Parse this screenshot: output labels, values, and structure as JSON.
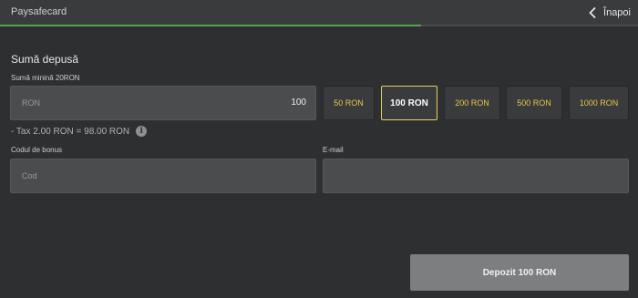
{
  "header": {
    "title": "Paysafecard",
    "back_label": "Înapoi",
    "back_icon": "chevron-left-icon"
  },
  "progress": {
    "fraction": 0.66,
    "color": "#4fa64a"
  },
  "deposit": {
    "section_title": "Sumă depusă",
    "min_label": "Sumă minină 20RON",
    "currency": "RON",
    "amount": "100",
    "presets": [
      {
        "label": "50 RON",
        "selected": false
      },
      {
        "label": "100 RON",
        "selected": true
      },
      {
        "label": "200 RON",
        "selected": false
      },
      {
        "label": "500 RON",
        "selected": false
      },
      {
        "label": "1000 RON",
        "selected": false
      }
    ],
    "tax_text": "- Tax 2.00 RON = 98.00 RON",
    "info_icon": "info-icon"
  },
  "form": {
    "bonus_label": "Codul de bonus",
    "bonus_placeholder": "Cod",
    "email_label": "E-mail",
    "email_placeholder": ""
  },
  "submit": {
    "label": "Depozit 100 RON"
  },
  "colors": {
    "accent": "#e6c84a",
    "selected_border": "#e8cf58",
    "background": "#2e2f30"
  }
}
